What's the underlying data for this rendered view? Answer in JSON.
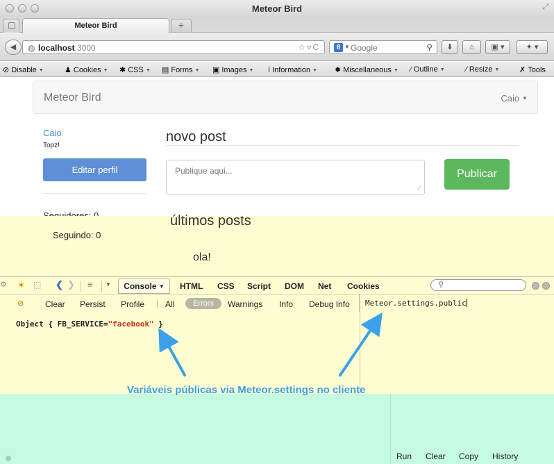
{
  "window": {
    "title": "Meteor Bird",
    "tab_title": "Meteor Bird",
    "new_tab_label": "+"
  },
  "navbar": {
    "url_host": "localhost",
    "url_rest": ":3000",
    "search_engine_badge": "8",
    "search_placeholder": "Google",
    "icons": [
      "back-arrow-icon",
      "globe-icon",
      "bookmark-star-icon",
      "reload-icon",
      "search-icon",
      "download-icon",
      "home-icon",
      "sync-icon",
      "addon-icon"
    ]
  },
  "webdev_toolbar": {
    "items": [
      {
        "label": "Disable",
        "icon": "⊘"
      },
      {
        "label": "Cookies",
        "icon": "♟"
      },
      {
        "label": "CSS",
        "icon": "✱"
      },
      {
        "label": "Forms",
        "icon": "▤"
      },
      {
        "label": "Images",
        "icon": "▣"
      },
      {
        "label": "Information",
        "icon": "ⅰ"
      },
      {
        "label": "Miscellaneous",
        "icon": "✹"
      },
      {
        "label": "Outline",
        "icon": "∕"
      },
      {
        "label": "Resize",
        "icon": "∕"
      },
      {
        "label": "Tools",
        "icon": "✗"
      }
    ]
  },
  "app": {
    "brand": "Meteor Bird",
    "user_menu": "Caio",
    "profile": {
      "name": "Caio",
      "bio": "Topz!",
      "edit_button": "Editar perfil",
      "followers": "Seguidores: 0",
      "following": "Seguindo: 0"
    },
    "new_post": {
      "heading": "novo post",
      "placeholder": "Publique aqui...",
      "publish_button": "Publicar"
    },
    "recent": {
      "heading": "últimos posts",
      "posts": [
        "ola!"
      ]
    }
  },
  "firebug": {
    "tabs": [
      "Console",
      "HTML",
      "CSS",
      "Script",
      "DOM",
      "Net",
      "Cookies"
    ],
    "console_filters": [
      "Clear",
      "Persist",
      "Profile",
      "All",
      "Errors",
      "Warnings",
      "Info",
      "Debug Info"
    ],
    "log_prefix": "Object { FB_SERVICE=",
    "log_value": "\"facebook\"",
    "log_suffix": " }",
    "command_line": "Meteor.settings.public",
    "command_actions": [
      "Run",
      "Clear",
      "Copy",
      "History"
    ]
  },
  "annotation": {
    "text": "Variáveis públicas via Meteor.settings no cliente",
    "color": "#3aa1ea"
  },
  "colors": {
    "edit_button": "#5f8fd6",
    "publish_button": "#5cb85c",
    "link": "#428bca",
    "overlay_yellow": "#fefdd2",
    "overlay_green": "#c5fbe0"
  }
}
